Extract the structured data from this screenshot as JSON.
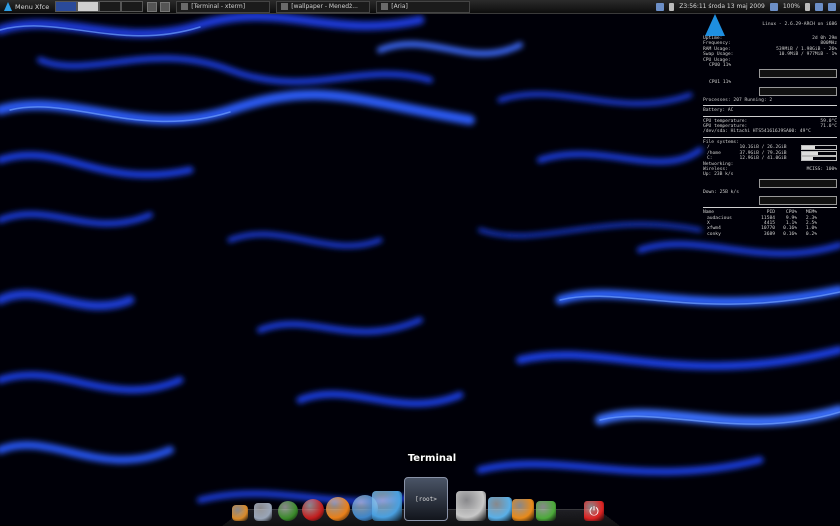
{
  "panel": {
    "menu_label": "Menu Xfce",
    "tasks": [
      "[Terminal - xterm]",
      "[wallpaper - Menedż...",
      "[Aria]"
    ],
    "clock": "Z3:56:11 środa 13 maj 2009",
    "battery": "100%"
  },
  "conky": {
    "kernel": "Linux - 2.6.29-ARCH on i686",
    "uptime_label": "Uptime:",
    "uptime": "2d 0h 29m",
    "frequency_label": "Frequency:",
    "frequency": "800MHz",
    "ram_label": "RAM Usage:",
    "ram": "539MiB / 1.98GiB - 26%",
    "swap_label": "Swap Usage:",
    "swap": "10.9MiB / 977MiB - 1%",
    "cpu_usage_label": "CPU Usage:",
    "cpu0": "CPU0 11%",
    "cpu1": "CPU1 11%",
    "processes": "Processes: 207  Running: 2",
    "battery_line": "Battery: AC",
    "cpu_temp_label": "CPU temperature:",
    "cpu_temp": "59.0°C",
    "gpu_temp_label": "GPU temperature:",
    "gpu_temp": "71.0°C",
    "disk_label": "/dev/sda: Hitachi HTS541616J9SA00: 49°C",
    "fs_label": "File systems:",
    "fs": [
      {
        "name": "/",
        "usage": "10.1GiB / 26.2GiB",
        "fill": 0.38
      },
      {
        "name": "/home",
        "usage": "37.9GiB / 79.2GiB",
        "fill": 0.48
      },
      {
        "name": "C:",
        "usage": "12.9GiB / 41.0GiB",
        "fill": 0.31
      }
    ],
    "net_label": "Networking:",
    "wireless_label": "Wireless:",
    "wireless": "MCISS: 100%",
    "up_label": "Up: 23B   k/s",
    "down_label": "Down: 25B   k/s",
    "proc_header": [
      "Name",
      "PID",
      "CPU%",
      "MEM%"
    ],
    "procs": [
      [
        "audacious",
        "11584",
        "9.9%",
        "2.3%"
      ],
      [
        "X",
        "4415",
        "1.1%",
        "2.5%"
      ],
      [
        "xfwm4",
        "10770",
        "0.16%",
        "1.0%"
      ],
      [
        "conky",
        "3689",
        "0.16%",
        "0.2%"
      ]
    ]
  },
  "dock": {
    "label": "Terminal",
    "icons": [
      {
        "name": "wrench-icon",
        "color": "#d88a2a"
      },
      {
        "name": "settings-tools-icon",
        "color": "#9aa6b8"
      },
      {
        "name": "globe-icon",
        "color": "#3a8a2a"
      },
      {
        "name": "opera-icon",
        "color": "#c21d1d"
      },
      {
        "name": "firefox-icon",
        "color": "#e8801a"
      },
      {
        "name": "thunderbird-icon",
        "color": "#3f86c9"
      },
      {
        "name": "file-manager-icon",
        "color": "#4aa0e0"
      },
      {
        "name": "terminal-icon",
        "color": "#2a2f3a"
      },
      {
        "name": "calculator-icon",
        "color": "#c8c8c8"
      },
      {
        "name": "image-viewer-icon",
        "color": "#5ab0e8"
      },
      {
        "name": "blender-icon",
        "color": "#e88a1a"
      },
      {
        "name": "windows-icon",
        "color": "#4caa3a"
      },
      {
        "name": "power-icon",
        "color": "#d22"
      }
    ]
  }
}
